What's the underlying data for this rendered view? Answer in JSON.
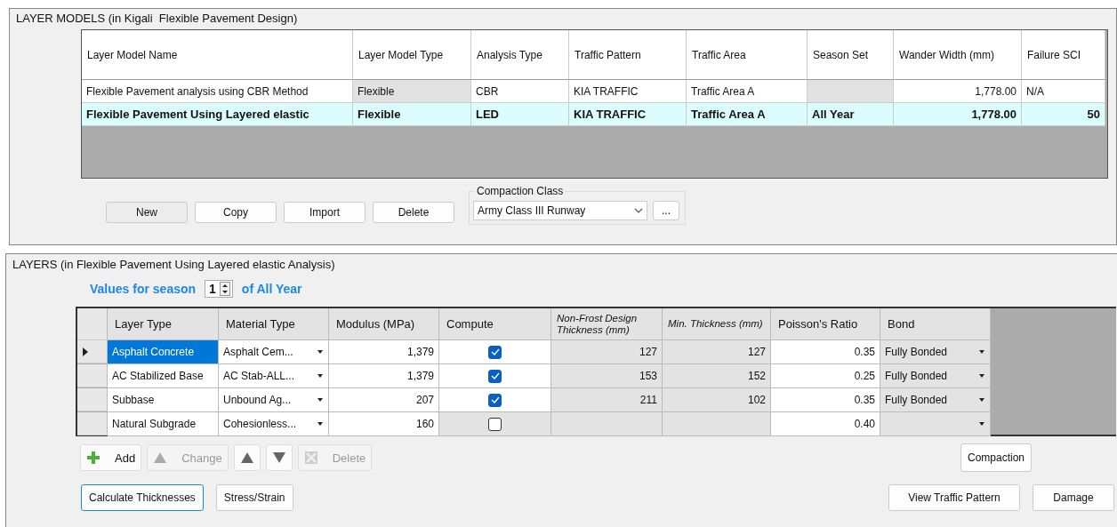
{
  "layer_models": {
    "title": "LAYER MODELS (in Kigali  Flexible Pavement Design)",
    "columns": [
      {
        "label": "Layer Model Name",
        "numeric": false
      },
      {
        "label": "Layer Model Type",
        "numeric": false
      },
      {
        "label": "Analysis Type",
        "numeric": false
      },
      {
        "label": "Traffic Pattern",
        "numeric": false
      },
      {
        "label": "Traffic Area",
        "numeric": false
      },
      {
        "label": "Season Set",
        "numeric": false
      },
      {
        "label": "Wander Width (mm)",
        "numeric": true
      },
      {
        "label": "Failure SCI",
        "numeric": false
      }
    ],
    "rows": [
      {
        "selected": false,
        "cells": [
          {
            "text": "Flexible Pavement analysis using CBR Method",
            "readonly": false
          },
          {
            "text": "Flexible",
            "readonly": true
          },
          {
            "text": "CBR",
            "readonly": false
          },
          {
            "text": "KIA TRAFFIC",
            "readonly": false
          },
          {
            "text": "Traffic Area A",
            "readonly": false
          },
          {
            "readonly": true
          },
          {
            "text": "1,778.00",
            "readonly": false
          },
          {
            "text": "N/A",
            "readonly": false
          }
        ]
      },
      {
        "selected": true,
        "cells": [
          {
            "text": "Flexible Pavement Using Layered elastic",
            "readonly": false
          },
          {
            "text": "Flexible",
            "readonly": false
          },
          {
            "text": "LED",
            "readonly": false
          },
          {
            "text": "KIA TRAFFIC",
            "readonly": false
          },
          {
            "text": "Traffic Area A",
            "readonly": false
          },
          {
            "text": "All Year",
            "readonly": false
          },
          {
            "text": "1,778.00",
            "readonly": false
          },
          {
            "text": "50",
            "readonly": false
          }
        ]
      }
    ],
    "buttons": [
      {
        "label": "New",
        "focused": true
      },
      {
        "label": "Copy",
        "focused": false
      },
      {
        "label": "Import",
        "focused": false
      },
      {
        "label": "Delete",
        "focused": false
      }
    ],
    "compaction_class": {
      "label": "Compaction Class",
      "value": "Army Class III Runway",
      "more_button": "..."
    }
  },
  "layers": {
    "title": "LAYERS (in Flexible Pavement Using Layered elastic Analysis)",
    "season": {
      "prefix": "Values for season",
      "value": "1",
      "suffix": "of All Year"
    },
    "columns": [
      {
        "label": "Layer Type",
        "italic": false
      },
      {
        "label": "Material Type",
        "italic": false
      },
      {
        "label": "Modulus (MPa)",
        "italic": false
      },
      {
        "label": "Compute",
        "italic": false
      },
      {
        "label": "Non-Frost Design Thickness (mm)",
        "italic": true
      },
      {
        "label": "Min. Thickness (mm)",
        "italic": true
      },
      {
        "label": "Poisson's Ratio",
        "italic": false
      },
      {
        "label": "Bond",
        "italic": false
      }
    ],
    "rows": [
      {
        "selected": true,
        "layer_type": "Asphalt Concrete",
        "material_type": "Asphalt Cem...",
        "modulus": "1,379",
        "compute": {
          "checked": true,
          "disabled": false
        },
        "non_frost_thickness": "127",
        "min_thickness": "127",
        "poisson_ratio": "0.35",
        "bond": "Fully Bonded"
      },
      {
        "selected": false,
        "layer_type": "AC Stabilized Base",
        "material_type": "AC Stab-ALL...",
        "modulus": "1,379",
        "compute": {
          "checked": true,
          "disabled": false
        },
        "non_frost_thickness": "153",
        "min_thickness": "152",
        "poisson_ratio": "0.25",
        "bond": "Fully Bonded"
      },
      {
        "selected": false,
        "layer_type": "Subbase",
        "material_type": "Unbound Ag...",
        "modulus": "207",
        "compute": {
          "checked": true,
          "disabled": false
        },
        "non_frost_thickness": "211",
        "min_thickness": "102",
        "poisson_ratio": "0.35",
        "bond": "Fully Bonded"
      },
      {
        "selected": false,
        "layer_type": "Natural Subgrade",
        "material_type": "Cohesionless...",
        "modulus": "160",
        "compute": {
          "checked": false,
          "disabled": true
        },
        "poisson_ratio": "0.40"
      }
    ],
    "toolbar": [
      {
        "kind": "add",
        "label": "Add",
        "disabled": false
      },
      {
        "kind": "change",
        "label": "Change",
        "disabled": true
      },
      {
        "kind": "up",
        "disabled": false
      },
      {
        "kind": "down",
        "disabled": false
      },
      {
        "kind": "delete",
        "label": "Delete",
        "disabled": true
      }
    ],
    "compaction_button": "Compaction",
    "bottom_left_buttons": [
      {
        "label": "Calculate Thicknesses",
        "focused": true
      },
      {
        "label": "Stress/Strain",
        "focused": false
      }
    ],
    "bottom_right_buttons": [
      {
        "label": "View Traffic Pattern",
        "focused": false
      },
      {
        "label": "Damage",
        "focused": false
      }
    ]
  }
}
